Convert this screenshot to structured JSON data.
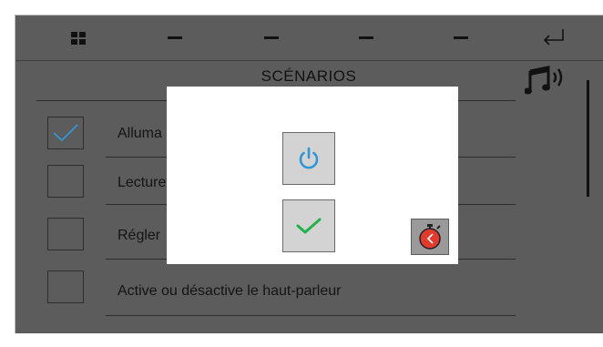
{
  "header": {
    "icons": [
      "grid-icon",
      "dash-icon",
      "dash-icon",
      "dash-icon",
      "dash-icon",
      "return-arrow-icon"
    ]
  },
  "page": {
    "title": "SCÉNARIOS"
  },
  "scenarios": [
    {
      "label": "Alluma",
      "checked": true
    },
    {
      "label": "Lecture",
      "checked": false
    },
    {
      "label": "Régler",
      "checked": false
    },
    {
      "label": "Active ou désactive le haut-parleur",
      "checked": false
    }
  ],
  "modal": {
    "buttons": [
      "power-icon",
      "check-icon",
      "timer-icon"
    ]
  },
  "colors": {
    "background": "#5c5c5c",
    "power_blue": "#2f97d6",
    "check_green": "#1fb34a",
    "timer_red": "#e23b2e"
  }
}
